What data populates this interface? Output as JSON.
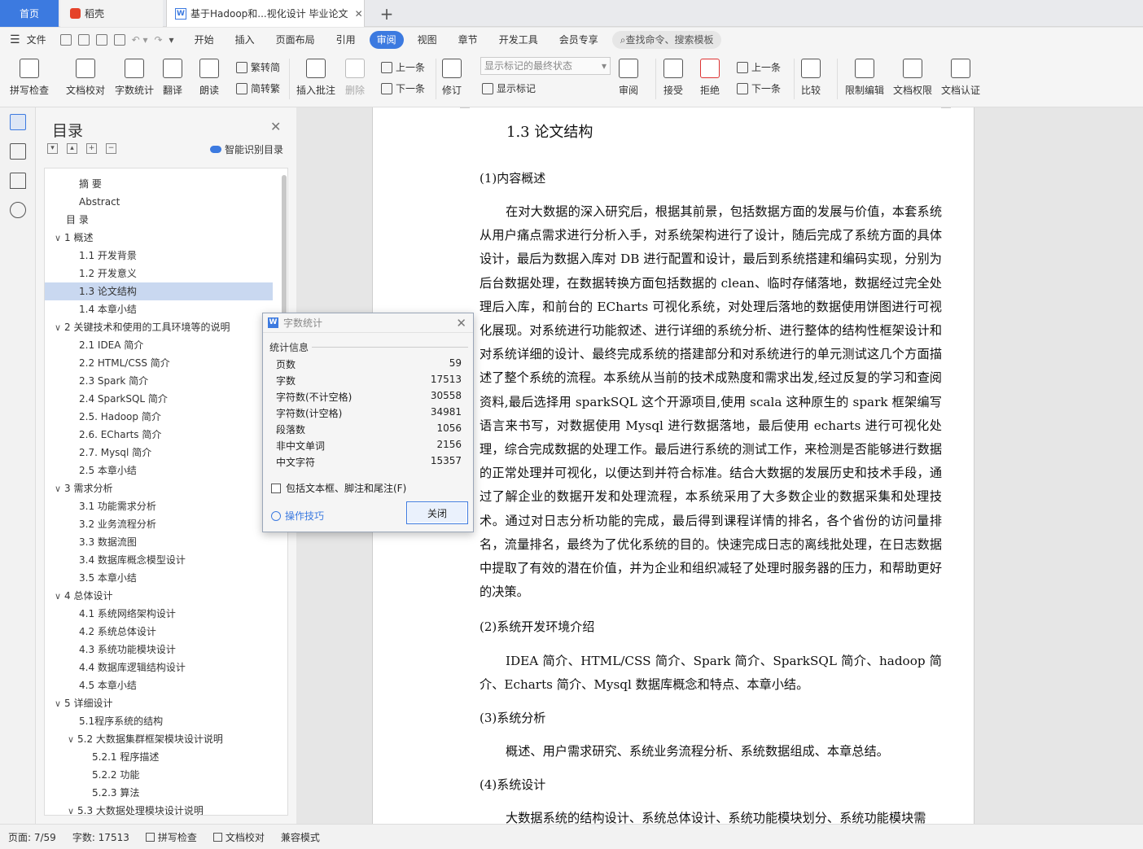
{
  "tabs": {
    "home": "首页",
    "daoke": "稻壳",
    "doc": "基于Hadoop和...视化设计 毕业论文",
    "add": "+"
  },
  "menu": {
    "file": "文件",
    "items": [
      "开始",
      "插入",
      "页面布局",
      "引用",
      "审阅",
      "视图",
      "章节",
      "开发工具",
      "会员专享"
    ],
    "active": "审阅",
    "search": "查找命令、搜索模板"
  },
  "ribbon": {
    "spell": "拼写检查",
    "proof": "文档校对",
    "wordcount": "字数统计",
    "translate": "翻译",
    "read": "朗读",
    "to_trad": "繁转简",
    "to_simp": "简转繁",
    "insert_comment": "插入批注",
    "delete": "删除",
    "prev": "上一条",
    "next": "下一条",
    "revise": "修订",
    "markup_state": "显示标记的最终状态",
    "show_markup": "显示标记",
    "review": "审阅",
    "accept": "接受",
    "reject": "拒绝",
    "prev2": "上一条",
    "next2": "下一条",
    "compare": "比较",
    "restrict": "限制编辑",
    "perm": "文档权限",
    "cert": "文档认证"
  },
  "toc": {
    "title": "目录",
    "smart": "智能识别目录",
    "items": [
      {
        "t": "摘  要",
        "lv": 1,
        "c": ""
      },
      {
        "t": "Abstract",
        "lv": 1,
        "c": ""
      },
      {
        "t": "目  录",
        "lv": 0,
        "c": ""
      },
      {
        "t": "1   概述",
        "lv": 0,
        "c": "v"
      },
      {
        "t": "1.1  开发背景",
        "lv": 1,
        "c": ""
      },
      {
        "t": "1.2  开发意义",
        "lv": 1,
        "c": ""
      },
      {
        "t": "1.3  论文结构",
        "lv": 1,
        "c": ""
      },
      {
        "t": "1.4  本章小结",
        "lv": 1,
        "c": ""
      },
      {
        "t": "2   关键技术和使用的工具环境等的说明",
        "lv": 0,
        "c": "v"
      },
      {
        "t": "2.1 IDEA 简介",
        "lv": 1,
        "c": ""
      },
      {
        "t": "2.2 HTML/CSS 简介",
        "lv": 1,
        "c": ""
      },
      {
        "t": "2.3 Spark 简介",
        "lv": 1,
        "c": ""
      },
      {
        "t": "2.4 SparkSQL 简介",
        "lv": 1,
        "c": ""
      },
      {
        "t": "2.5. Hadoop 简介",
        "lv": 1,
        "c": ""
      },
      {
        "t": "2.6. ECharts 简介",
        "lv": 1,
        "c": ""
      },
      {
        "t": "2.7. Mysql 简介",
        "lv": 1,
        "c": ""
      },
      {
        "t": "2.5  本章小结",
        "lv": 1,
        "c": ""
      },
      {
        "t": "3   需求分析",
        "lv": 0,
        "c": "v"
      },
      {
        "t": "3.1  功能需求分析",
        "lv": 1,
        "c": ""
      },
      {
        "t": "3.2  业务流程分析",
        "lv": 1,
        "c": ""
      },
      {
        "t": "3.3  数据流图",
        "lv": 1,
        "c": ""
      },
      {
        "t": "3.4  数据库概念模型设计",
        "lv": 1,
        "c": ""
      },
      {
        "t": "3.5  本章小结",
        "lv": 1,
        "c": ""
      },
      {
        "t": "4   总体设计",
        "lv": 0,
        "c": "v"
      },
      {
        "t": "4.1  系统网络架构设计",
        "lv": 1,
        "c": ""
      },
      {
        "t": "4.2  系统总体设计",
        "lv": 1,
        "c": ""
      },
      {
        "t": "4.3  系统功能模块设计",
        "lv": 1,
        "c": ""
      },
      {
        "t": "4.4  数据库逻辑结构设计",
        "lv": 1,
        "c": ""
      },
      {
        "t": "4.5  本章小结",
        "lv": 1,
        "c": ""
      },
      {
        "t": "5   详细设计",
        "lv": 0,
        "c": "v"
      },
      {
        "t": "5.1程序系统的结构",
        "lv": 1,
        "c": ""
      },
      {
        "t": "5.2    大数据集群框架模块设计说明",
        "lv": 1,
        "c": "v"
      },
      {
        "t": "5.2.1  程序描述",
        "lv": 2,
        "c": ""
      },
      {
        "t": "5.2.2  功能",
        "lv": 2,
        "c": ""
      },
      {
        "t": "5.2.3  算法",
        "lv": 2,
        "c": ""
      },
      {
        "t": "5.3    大数据处理模块设计说明",
        "lv": 1,
        "c": "v"
      }
    ]
  },
  "doc": {
    "heading": "1.3  论文结构",
    "s1": "(1)内容概述",
    "p1": "在对大数据的深入研究后，根据其前景，包括数据方面的发展与价值，本套系统从用户痛点需求进行分析入手，对系统架构进行了设计，随后完成了系统方面的具体设计，最后为数据入库对 DB 进行配置和设计，最后到系统搭建和编码实现，分别为后台数据处理，在数据转换方面包括数据的 clean、临时存储落地，数据经过完全处理后入库，和前台的 ECharts 可视化系统，对处理后落地的数据使用饼图进行可视化展现。对系统进行功能叙述、进行详细的系统分析、进行整体的结构性框架设计和对系统详细的设计、最终完成系统的搭建部分和对系统进行的单元测试这几个方面描述了整个系统的流程。本系统从当前的技术成熟度和需求出发,经过反复的学习和查阅资料,最后选择用 sparkSQL 这个开源项目,使用 scala 这种原生的 spark 框架编写语言来书写，对数据使用 Mysql 进行数据落地，最后使用 echarts 进行可视化处理，综合完成数据的处理工作。最后进行系统的测试工作，来检测是否能够进行数据的正常处理并可视化，以便达到并符合标准。结合大数据的发展历史和技术手段，通过了解企业的数据开发和处理流程，本系统采用了大多数企业的数据采集和处理技术。通过对日志分析功能的完成，最后得到课程详情的排名，各个省份的访问量排名，流量排名，最终为了优化系统的目的。快速完成日志的离线批处理，在日志数据中提取了有效的潜在价值，并为企业和组织减轻了处理时服务器的压力，和帮助更好的决策。",
    "s2": "(2)系统开发环境介绍",
    "p2": "IDEA 简介、HTML/CSS 简介、Spark 简介、SparkSQL 简介、hadoop 简介、Echarts 简介、Mysql 数据库概念和特点、本章小结。",
    "s3": "(3)系统分析",
    "p3": "概述、用户需求研究、系统业务流程分析、系统数据组成、本章总结。",
    "s4": "(4)系统设计",
    "p4": "大数据系统的结构设计、系统总体设计、系统功能模块划分、系统功能模块需"
  },
  "dialog": {
    "title": "字数统计",
    "section": "统计信息",
    "stats": [
      {
        "k": "页数",
        "v": "59"
      },
      {
        "k": "字数",
        "v": "17513"
      },
      {
        "k": "字符数(不计空格)",
        "v": "30558"
      },
      {
        "k": "字符数(计空格)",
        "v": "34981"
      },
      {
        "k": "段落数",
        "v": "1056"
      },
      {
        "k": "非中文单词",
        "v": "2156"
      },
      {
        "k": "中文字符",
        "v": "15357"
      }
    ],
    "include": "包括文本框、脚注和尾注(F)",
    "tips": "操作技巧",
    "close": "关闭"
  },
  "status": {
    "page": "页面: 7/59",
    "words": "字数: 17513",
    "spell": "拼写检查",
    "proof": "文档校对",
    "compat": "兼容模式"
  }
}
